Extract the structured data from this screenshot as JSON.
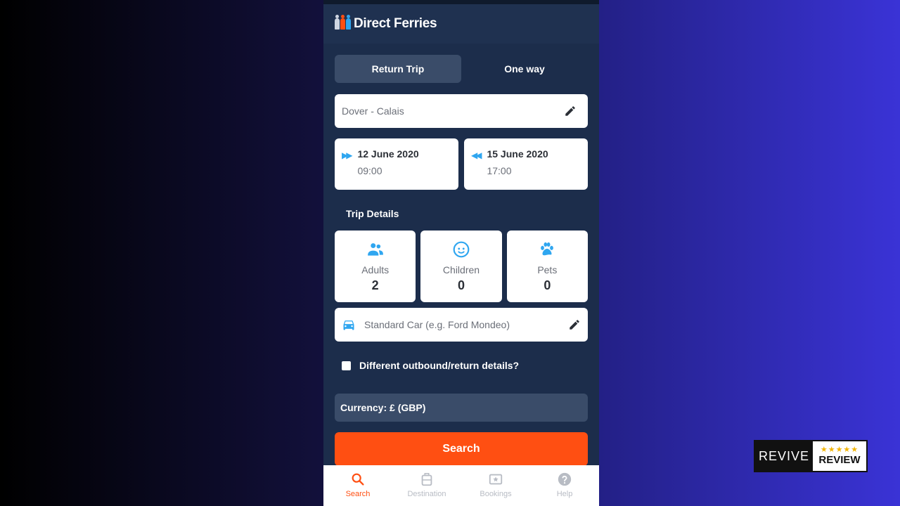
{
  "app": {
    "title": "Direct Ferries"
  },
  "trip_toggle": {
    "return_label": "Return Trip",
    "oneway_label": "One way"
  },
  "route": {
    "value": "Dover - Calais",
    "icon": "pencil-icon"
  },
  "outbound": {
    "date": "12 June 2020",
    "time": "09:00",
    "icon": "fast-forward-icon"
  },
  "return": {
    "date": "15 June 2020",
    "time": "17:00",
    "icon": "rewind-icon"
  },
  "trip_details": {
    "heading": "Trip Details",
    "adults": {
      "label": "Adults",
      "value": "2",
      "icon": "people-icon"
    },
    "children": {
      "label": "Children",
      "value": "0",
      "icon": "child-face-icon"
    },
    "pets": {
      "label": "Pets",
      "value": "0",
      "icon": "paw-icon"
    }
  },
  "vehicle": {
    "value": "Standard Car (e.g. Ford Mondeo)",
    "icon": "car-icon"
  },
  "different_details": {
    "label": "Different outbound/return details?",
    "checked": false
  },
  "currency": {
    "label": "Currency: £ (GBP)"
  },
  "search_button": {
    "label": "Search"
  },
  "bottom_nav": [
    {
      "label": "Search",
      "icon": "search-icon",
      "active": true
    },
    {
      "label": "Destination",
      "icon": "luggage-icon",
      "active": false
    },
    {
      "label": "Bookings",
      "icon": "ticket-icon",
      "active": false
    },
    {
      "label": "Help",
      "icon": "help-icon",
      "active": false
    }
  ],
  "colors": {
    "background": "#1c2d4b",
    "accent": "#ff4f12",
    "icon_blue": "#2fa6f0",
    "toggle_active": "#3a4c69"
  },
  "watermark": {
    "left": "REVIVE",
    "right": "REVIEW",
    "stars": "★★★★★"
  }
}
